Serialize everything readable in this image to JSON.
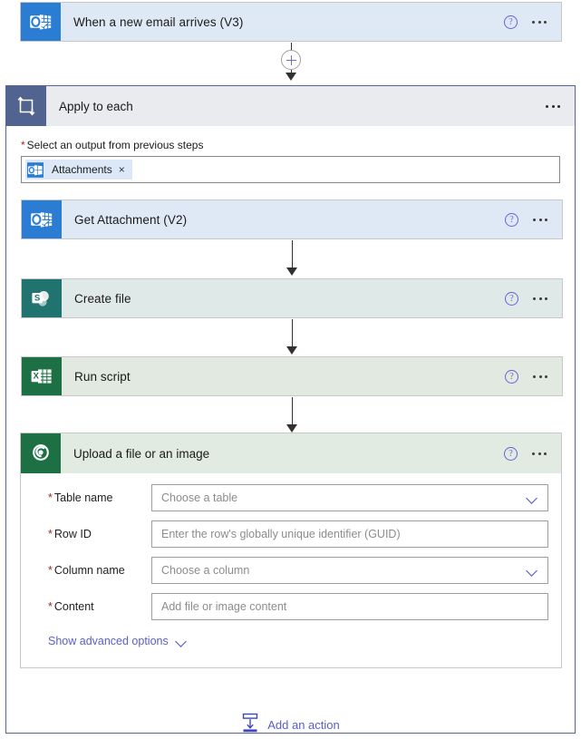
{
  "flow": {
    "trigger": {
      "title": "When a new email arrives (V3)",
      "icon": "outlook-icon",
      "connector": "outlook",
      "help_label": "?",
      "menu_label": "More commands"
    },
    "scope": {
      "title": "Apply to each",
      "icon": "foreach-loop-icon",
      "menu_label": "More commands",
      "field": {
        "label": "Select an output from previous steps",
        "required_marker": "*",
        "token": {
          "label": "Attachments",
          "icon": "outlook-icon",
          "remove_label": "×"
        }
      },
      "actions": [
        {
          "title": "Get Attachment (V2)",
          "icon": "outlook-icon",
          "connector": "outlook",
          "help_label": "?"
        },
        {
          "title": "Create file",
          "icon": "sharepoint-icon",
          "connector": "sharepoint",
          "help_label": "?"
        },
        {
          "title": "Run script",
          "icon": "excel-icon",
          "connector": "excel",
          "help_label": "?"
        }
      ],
      "upload_action": {
        "title": "Upload a file or an image",
        "icon": "dataverse-icon",
        "connector": "dataverse",
        "help_label": "?",
        "fields": [
          {
            "label": "Table name",
            "required_marker": "*",
            "placeholder": "Choose a table",
            "value": "",
            "control": "dropdown"
          },
          {
            "label": "Row ID",
            "required_marker": "*",
            "placeholder": "Enter the row's globally unique identifier (GUID)",
            "value": "",
            "control": "text"
          },
          {
            "label": "Column name",
            "required_marker": "*",
            "placeholder": "Choose a column",
            "value": "",
            "control": "dropdown"
          },
          {
            "label": "Content",
            "required_marker": "*",
            "placeholder": "Add file or image content",
            "value": "",
            "control": "text"
          }
        ],
        "advanced_options_label": "Show advanced options"
      }
    },
    "add_action": {
      "label": "Add an action",
      "icon": "insert-action-icon"
    },
    "colors": {
      "outlook_brand": "#2b7cd3",
      "outlook_card_bg": "#dfe9f6",
      "sharepoint_brand": "#21736f",
      "sharepoint_card_bg": "#dfe9e8",
      "excel_brand": "#1d7044",
      "excel_card_bg": "#e1e9e1",
      "dataverse_brand": "#1d7044",
      "dataverse_card_bg": "#e1ebe2",
      "scope_brand": "#51638f",
      "scope_header_bg": "#e9ebee",
      "link": "#5b5fc7",
      "required": "#a4262c",
      "connector_line": "#323130"
    }
  }
}
